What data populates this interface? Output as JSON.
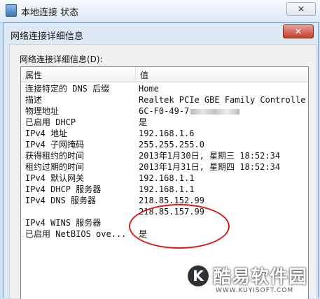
{
  "outer_window": {
    "title": "本地连接 状态",
    "close_label": "✕"
  },
  "dialog": {
    "title": "网络连接详细信息",
    "close_label": "✕",
    "group_label": "网络连接详细信息(D):",
    "columns": {
      "property": "属性",
      "value": "值"
    },
    "rows": [
      {
        "property": "连接特定的 DNS 后缀",
        "value": "Home"
      },
      {
        "property": "描述",
        "value": "Realtek PCIe GBE Family Controlle"
      },
      {
        "property": "物理地址",
        "value": "6C-F0-49-7"
      },
      {
        "property": "已启用 DHCP",
        "value": "是"
      },
      {
        "property": "IPv4 地址",
        "value": "192.168.1.6"
      },
      {
        "property": "IPv4 子网掩码",
        "value": "255.255.255.0"
      },
      {
        "property": "获得租约的时间",
        "value": "2013年1月30日, 星期三 18:52:34"
      },
      {
        "property": "租约过期的时间",
        "value": "2013年1月31日, 星期四 18:52:34"
      },
      {
        "property": "IPv4 默认网关",
        "value": "192.168.1.1"
      },
      {
        "property": "IPv4 DHCP 服务器",
        "value": "192.168.1.1"
      },
      {
        "property": "IPv4 DNS 服务器",
        "value": "218.85.152.99"
      },
      {
        "property": "",
        "value": "218.85.157.99"
      },
      {
        "property": "IPv4 WINS 服务器",
        "value": ""
      },
      {
        "property": "已启用 NetBIOS ove...",
        "value": "是"
      }
    ]
  },
  "watermark": {
    "logo": "K",
    "text": "酷易软件园",
    "sub": "WWW.KUYISOFT.COM"
  }
}
